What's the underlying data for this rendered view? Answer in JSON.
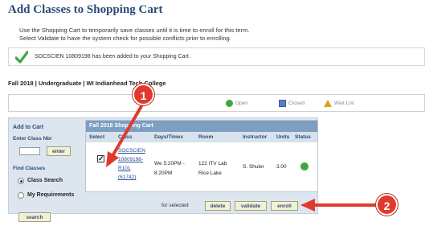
{
  "page": {
    "title": "Add Classes to Shopping Cart",
    "instruction_1": "Use the Shopping Cart to temporarily save classes until it is time to enroll for this term.",
    "instruction_2": "Select Validate to have the system check for possible conflicts prior to enrolling."
  },
  "message": {
    "text": "SOCSCIEN 10809198 has been added to your Shopping Cart.",
    "icon": "checkmark-icon",
    "icon_color": "#3fa73f"
  },
  "term": "Fall 2018 | Undergraduate | WI Indianhead Tech College",
  "legend": {
    "open": "Open",
    "closed": "Closed",
    "wait_list": "Wait List"
  },
  "sidebar": {
    "header": "Add to Cart",
    "enter_class_nbr": "Enter Class Nbr",
    "enter_button": "enter",
    "find_classes": "Find Classes",
    "class_search": "Class Search",
    "my_requirements": "My Requirements",
    "search_button": "search"
  },
  "cart": {
    "title": "Fall 2018 Shopping Cart",
    "columns": [
      "Select",
      "Class",
      "Days/Times",
      "Room",
      "Instructor",
      "Units",
      "Status"
    ],
    "row": {
      "class_line1": "SOCSCIEN",
      "class_line2": "10809198-",
      "class_line3": "R101",
      "class_line4": "(61742)",
      "days_line1": "We 5:20PM -",
      "days_line2": "8:20PM",
      "room_line1": "122 ITV Lab",
      "room_line2": "Rice Lake",
      "instructor": "S. Shuler",
      "units": "3.00",
      "status": "open"
    },
    "for_selected": "for selected",
    "delete_button": "delete",
    "validate_button": "validate",
    "enroll_button": "enroll"
  },
  "annotations": {
    "marker_1": "1",
    "marker_2": "2",
    "color": "#e03a2e"
  }
}
